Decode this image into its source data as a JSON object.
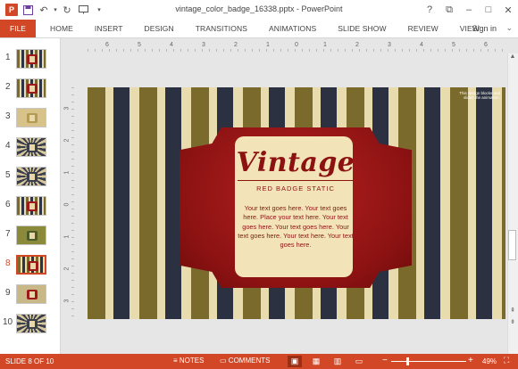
{
  "window": {
    "title": "vintage_color_badge_16338.pptx - PowerPoint",
    "help": "?",
    "controls": [
      "⧉",
      "–",
      "□",
      "✕"
    ]
  },
  "ribbon": {
    "file": "FILE",
    "tabs": [
      "HOME",
      "INSERT",
      "DESIGN",
      "TRANSITIONS",
      "ANIMATIONS",
      "SLIDE SHOW",
      "REVIEW",
      "VIEW"
    ],
    "signin": "Sign in"
  },
  "thumbnails": [
    {
      "num": "1"
    },
    {
      "num": "2"
    },
    {
      "num": "3"
    },
    {
      "num": "4"
    },
    {
      "num": "5"
    },
    {
      "num": "6"
    },
    {
      "num": "7"
    },
    {
      "num": "8"
    },
    {
      "num": "9"
    },
    {
      "num": "10"
    }
  ],
  "ruler": {
    "top": [
      "6",
      "5",
      "4",
      "3",
      "2",
      "1",
      "0",
      "1",
      "2",
      "3",
      "4",
      "5",
      "6"
    ],
    "left": [
      "3",
      "2",
      "1",
      "0",
      "1",
      "2",
      "3"
    ]
  },
  "slide": {
    "note": "This design blocks and slides the animation.",
    "badge": {
      "title": "Vintage",
      "subtitle": "RED BADGE STATIC",
      "body": "Your text goes here. Your text goes here. Place your text here. Your text goes here. Your text goes here. Your text goes here. Your text here. Your text goes here."
    },
    "colors": {
      "olive": "#7a6a2c",
      "cream": "#e8dcae",
      "navy": "#2b3141",
      "red": "#8c1212"
    }
  },
  "status": {
    "slide_info": "SLIDE 8 OF 10",
    "notes": "NOTES",
    "comments": "COMMENTS",
    "zoom": "49%",
    "zoom_level": 0.49
  }
}
